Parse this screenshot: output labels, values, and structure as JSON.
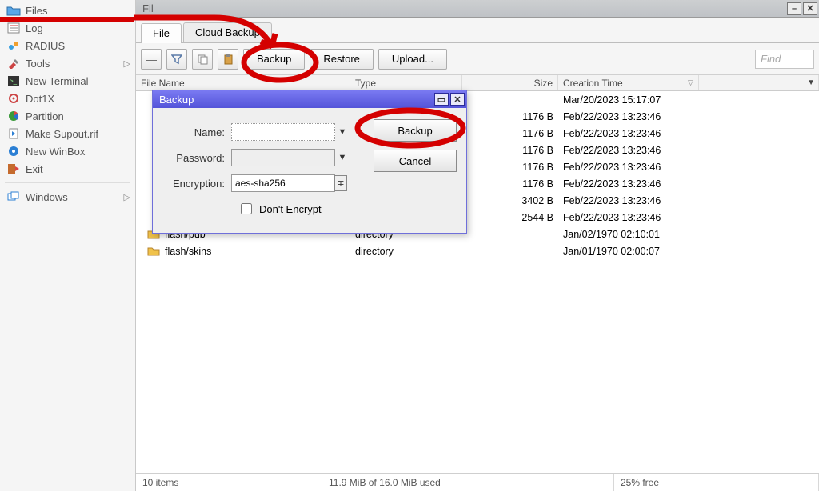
{
  "sidebar": {
    "items": [
      {
        "label": "Files",
        "icon": "folder-icon",
        "sub": false
      },
      {
        "label": "Log",
        "icon": "log-icon",
        "sub": false
      },
      {
        "label": "RADIUS",
        "icon": "radius-icon",
        "sub": false
      },
      {
        "label": "Tools",
        "icon": "tools-icon",
        "sub": true
      },
      {
        "label": "New Terminal",
        "icon": "terminal-icon",
        "sub": false
      },
      {
        "label": "Dot1X",
        "icon": "dot1x-icon",
        "sub": false
      },
      {
        "label": "Partition",
        "icon": "partition-icon",
        "sub": false
      },
      {
        "label": "Make Supout.rif",
        "icon": "supout-icon",
        "sub": false
      },
      {
        "label": "New WinBox",
        "icon": "winbox-icon",
        "sub": false
      },
      {
        "label": "Exit",
        "icon": "exit-icon",
        "sub": false
      }
    ],
    "windows_label": "Windows"
  },
  "window": {
    "title_partial": "Fil",
    "tabs": [
      {
        "label": "File",
        "active": true
      },
      {
        "label": "Cloud Backup",
        "active": false
      }
    ],
    "toolbar": {
      "backup": "Backup",
      "restore": "Restore",
      "upload": "Upload...",
      "find_placeholder": "Find"
    },
    "columns": {
      "name": "File Name",
      "type": "Type",
      "size": "Size",
      "time": "Creation Time"
    },
    "rows_visible": [
      {
        "name": "",
        "type": "",
        "size": "",
        "time": "Mar/20/2023 15:17:07"
      },
      {
        "name": "",
        "type": "",
        "size": "1176 B",
        "time": "Feb/22/2023 13:23:46"
      },
      {
        "name": "",
        "type": "",
        "size": "1176 B",
        "time": "Feb/22/2023 13:23:46"
      },
      {
        "name": "",
        "type": "",
        "size": "1176 B",
        "time": "Feb/22/2023 13:23:46"
      },
      {
        "name": "",
        "type": "",
        "size": "1176 B",
        "time": "Feb/22/2023 13:23:46"
      },
      {
        "name": "",
        "type": "",
        "size": "1176 B",
        "time": "Feb/22/2023 13:23:46"
      },
      {
        "name": "",
        "type": "",
        "size": "3402 B",
        "time": "Feb/22/2023 13:23:46"
      },
      {
        "name": "",
        "type": "",
        "size": "2544 B",
        "time": "Feb/22/2023 13:23:46"
      },
      {
        "name": "flash/pub",
        "type": "directory",
        "size": "",
        "time": "Jan/02/1970 02:10:01"
      },
      {
        "name": "flash/skins",
        "type": "directory",
        "size": "",
        "time": "Jan/01/1970 02:00:07"
      }
    ],
    "status": {
      "count": "10 items",
      "usage": "11.9 MiB of 16.0 MiB used",
      "free": "25% free"
    }
  },
  "dialog": {
    "title": "Backup",
    "name_label": "Name:",
    "name_value": "",
    "password_label": "Password:",
    "password_value": "",
    "encryption_label": "Encryption:",
    "encryption_value": "aes-sha256",
    "dont_encrypt_label": "Don't Encrypt",
    "backup_btn": "Backup",
    "cancel_btn": "Cancel"
  }
}
